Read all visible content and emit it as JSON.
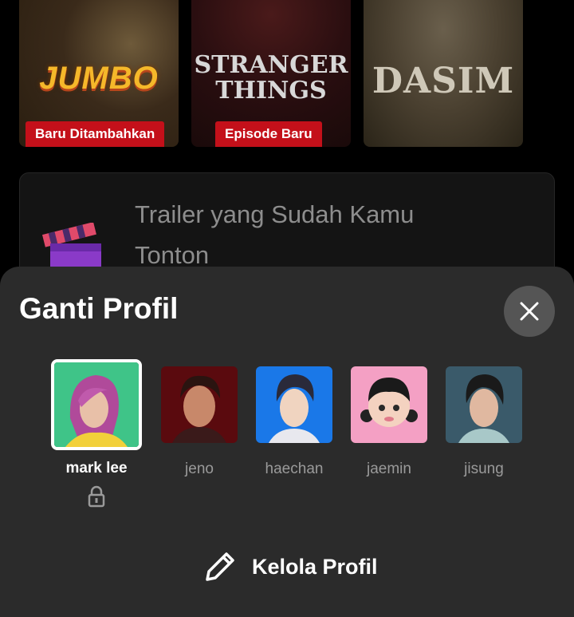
{
  "posters": [
    {
      "title": "JUMBO",
      "badge": "Baru Ditambahkan"
    },
    {
      "title_line1": "STRANGER",
      "title_line2": "THINGS",
      "badge": "Episode Baru"
    },
    {
      "title": "DASIM"
    }
  ],
  "trailer_card": {
    "title": "Trailer yang Sudah Kamu Tonton"
  },
  "sheet": {
    "title": "Ganti Profil",
    "profiles": [
      {
        "name": "mark lee",
        "selected": true,
        "locked": true
      },
      {
        "name": "jeno"
      },
      {
        "name": "haechan"
      },
      {
        "name": "jaemin"
      },
      {
        "name": "jisung"
      }
    ],
    "manage_label": "Kelola Profil"
  },
  "colors": {
    "badge_red": "#c4101a",
    "sheet_bg": "#2b2b2b",
    "close_bg": "#555555"
  },
  "icons": [
    "clapperboard-icon",
    "close-icon",
    "lock-icon",
    "pencil-icon"
  ]
}
